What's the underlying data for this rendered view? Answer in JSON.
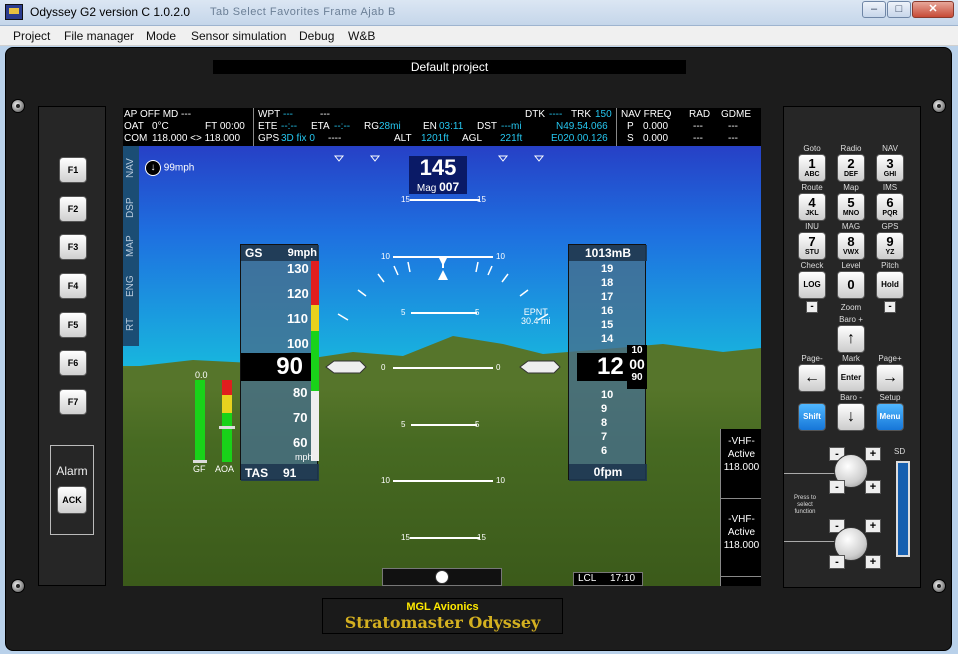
{
  "window": {
    "title": "Odyssey G2 version C 1.0.2.0",
    "ghost_text": "Tab   Select   Favorites   Frame   Ajab   B",
    "min_label": "–",
    "max_label": "□",
    "close_label": "✕"
  },
  "menu": [
    "Project",
    "File manager",
    "Mode",
    "Sensor simulation",
    "Debug",
    "W&B"
  ],
  "project_name": "Default project",
  "left_panel": {
    "fkeys": [
      "F1",
      "F2",
      "F3",
      "F4",
      "F5",
      "F6",
      "F7"
    ],
    "alarm_label": "Alarm",
    "ack_label": "ACK"
  },
  "info": {
    "ap_line": "AP OFF  MD ---",
    "oat_label": "OAT",
    "oat_value": "0°C",
    "ft_label": "FT 00:00",
    "com_label": "COM",
    "com_value": "118.000 <> 118.000",
    "wpt_label": "WPT",
    "wpt_value": "---",
    "wpt_dash": "---",
    "ete_label": "ETE",
    "ete_value": "--:--",
    "eta_label": "ETA",
    "eta_value": "--:--",
    "rg_label": "RG",
    "rg_value": "28mi",
    "en_label": "EN",
    "en_value": "03:11",
    "dst_label": "DST",
    "dst_value": "---mi",
    "gps_label": "GPS",
    "gps_value": "3D fix 0",
    "gps_dash": "----",
    "alt_label": "ALT",
    "alt_value": "1201ft",
    "agl_label": "AGL",
    "agl_value": "221ft",
    "dtk_label": "DTK",
    "dtk_value": "----",
    "trk_label": "TRK",
    "trk_value": "150",
    "lat": "N49.54.066",
    "lon": "E020.00.126",
    "navfreq_label": "NAV  FREQ",
    "p_label": "P",
    "p_value": "0.000",
    "s_label": "S",
    "s_value": "0.000",
    "rad_label": "RAD",
    "rad_p": "---",
    "rad_s": "---",
    "gdme_label": "GDME",
    "gdme_p": "---",
    "gdme_s": "---"
  },
  "side_tabs": [
    "NAV",
    "DSP",
    "MAP",
    "ENG",
    "RT"
  ],
  "wind": "99mph",
  "heading": {
    "value": "145",
    "mag_label": "Mag",
    "mag_value": "007"
  },
  "pitch_labels": {
    "p15": "15",
    "p10": "10",
    "p5": "5",
    "p0": "0"
  },
  "waypoint": {
    "name": "EPNT",
    "dist": "30.4 mi"
  },
  "speed": {
    "gs_label": "GS",
    "gs_value": "9mph",
    "ticks": [
      "130",
      "120",
      "110",
      "100",
      "80",
      "70",
      "60"
    ],
    "current": "90",
    "unit": "mph",
    "tas_label": "TAS",
    "tas_value": "91"
  },
  "altitude": {
    "baro": "1013mB",
    "ticks": [
      "19",
      "18",
      "17",
      "16",
      "15",
      "14",
      "10",
      "9",
      "8",
      "7",
      "6"
    ],
    "current": "12",
    "drum": [
      "10",
      "00",
      "90"
    ],
    "vs": "0fpm"
  },
  "gauges": {
    "gf_value": "0.0",
    "gf_label": "GF",
    "aoa_label": "AOA"
  },
  "vhf": [
    {
      "title": "-VHF-",
      "state": "Active",
      "freq": "118.000"
    },
    {
      "title": "-VHF-",
      "state": "Active",
      "freq": "118.000"
    }
  ],
  "clock": {
    "label": "LCL",
    "time": "17:10"
  },
  "logo": {
    "line1": "MGL Avionics",
    "line2": "Stratomaster Odyssey"
  },
  "keypad": {
    "rows": [
      [
        {
          "cap": "Goto",
          "num": "1",
          "sub": "ABC"
        },
        {
          "cap": "Radio",
          "num": "2",
          "sub": "DEF"
        },
        {
          "cap": "NAV",
          "num": "3",
          "sub": "GHI"
        }
      ],
      [
        {
          "cap": "Route",
          "num": "4",
          "sub": "JKL"
        },
        {
          "cap": "Map",
          "num": "5",
          "sub": "MNO"
        },
        {
          "cap": "IMS",
          "num": "6",
          "sub": "PQR"
        }
      ],
      [
        {
          "cap": "INU",
          "num": "7",
          "sub": "STU"
        },
        {
          "cap": "MAG",
          "num": "8",
          "sub": "VWX"
        },
        {
          "cap": "GPS",
          "num": "9",
          "sub": "YZ"
        }
      ],
      [
        {
          "cap": "Check",
          "num": "LOG",
          "sub": ""
        },
        {
          "cap": "Level",
          "num": "0",
          "sub": ""
        },
        {
          "cap": "Pitch",
          "num": "Hold",
          "sub": ""
        }
      ]
    ],
    "zoom_label": "Zoom",
    "baro_plus": "Baro +",
    "baro_minus": "Baro -",
    "page_minus": "Page-",
    "page_plus": "Page+",
    "mark": "Mark",
    "enter": "Enter",
    "setup": "Setup",
    "shift": "Shift",
    "menu": "Menu",
    "sd_label": "SD",
    "func_label": "Press to select function",
    "up_arrow": "↑",
    "down_arrow": "↓",
    "left_arrow": "←",
    "right_arrow": "→",
    "minus": "-",
    "plus": "+"
  }
}
